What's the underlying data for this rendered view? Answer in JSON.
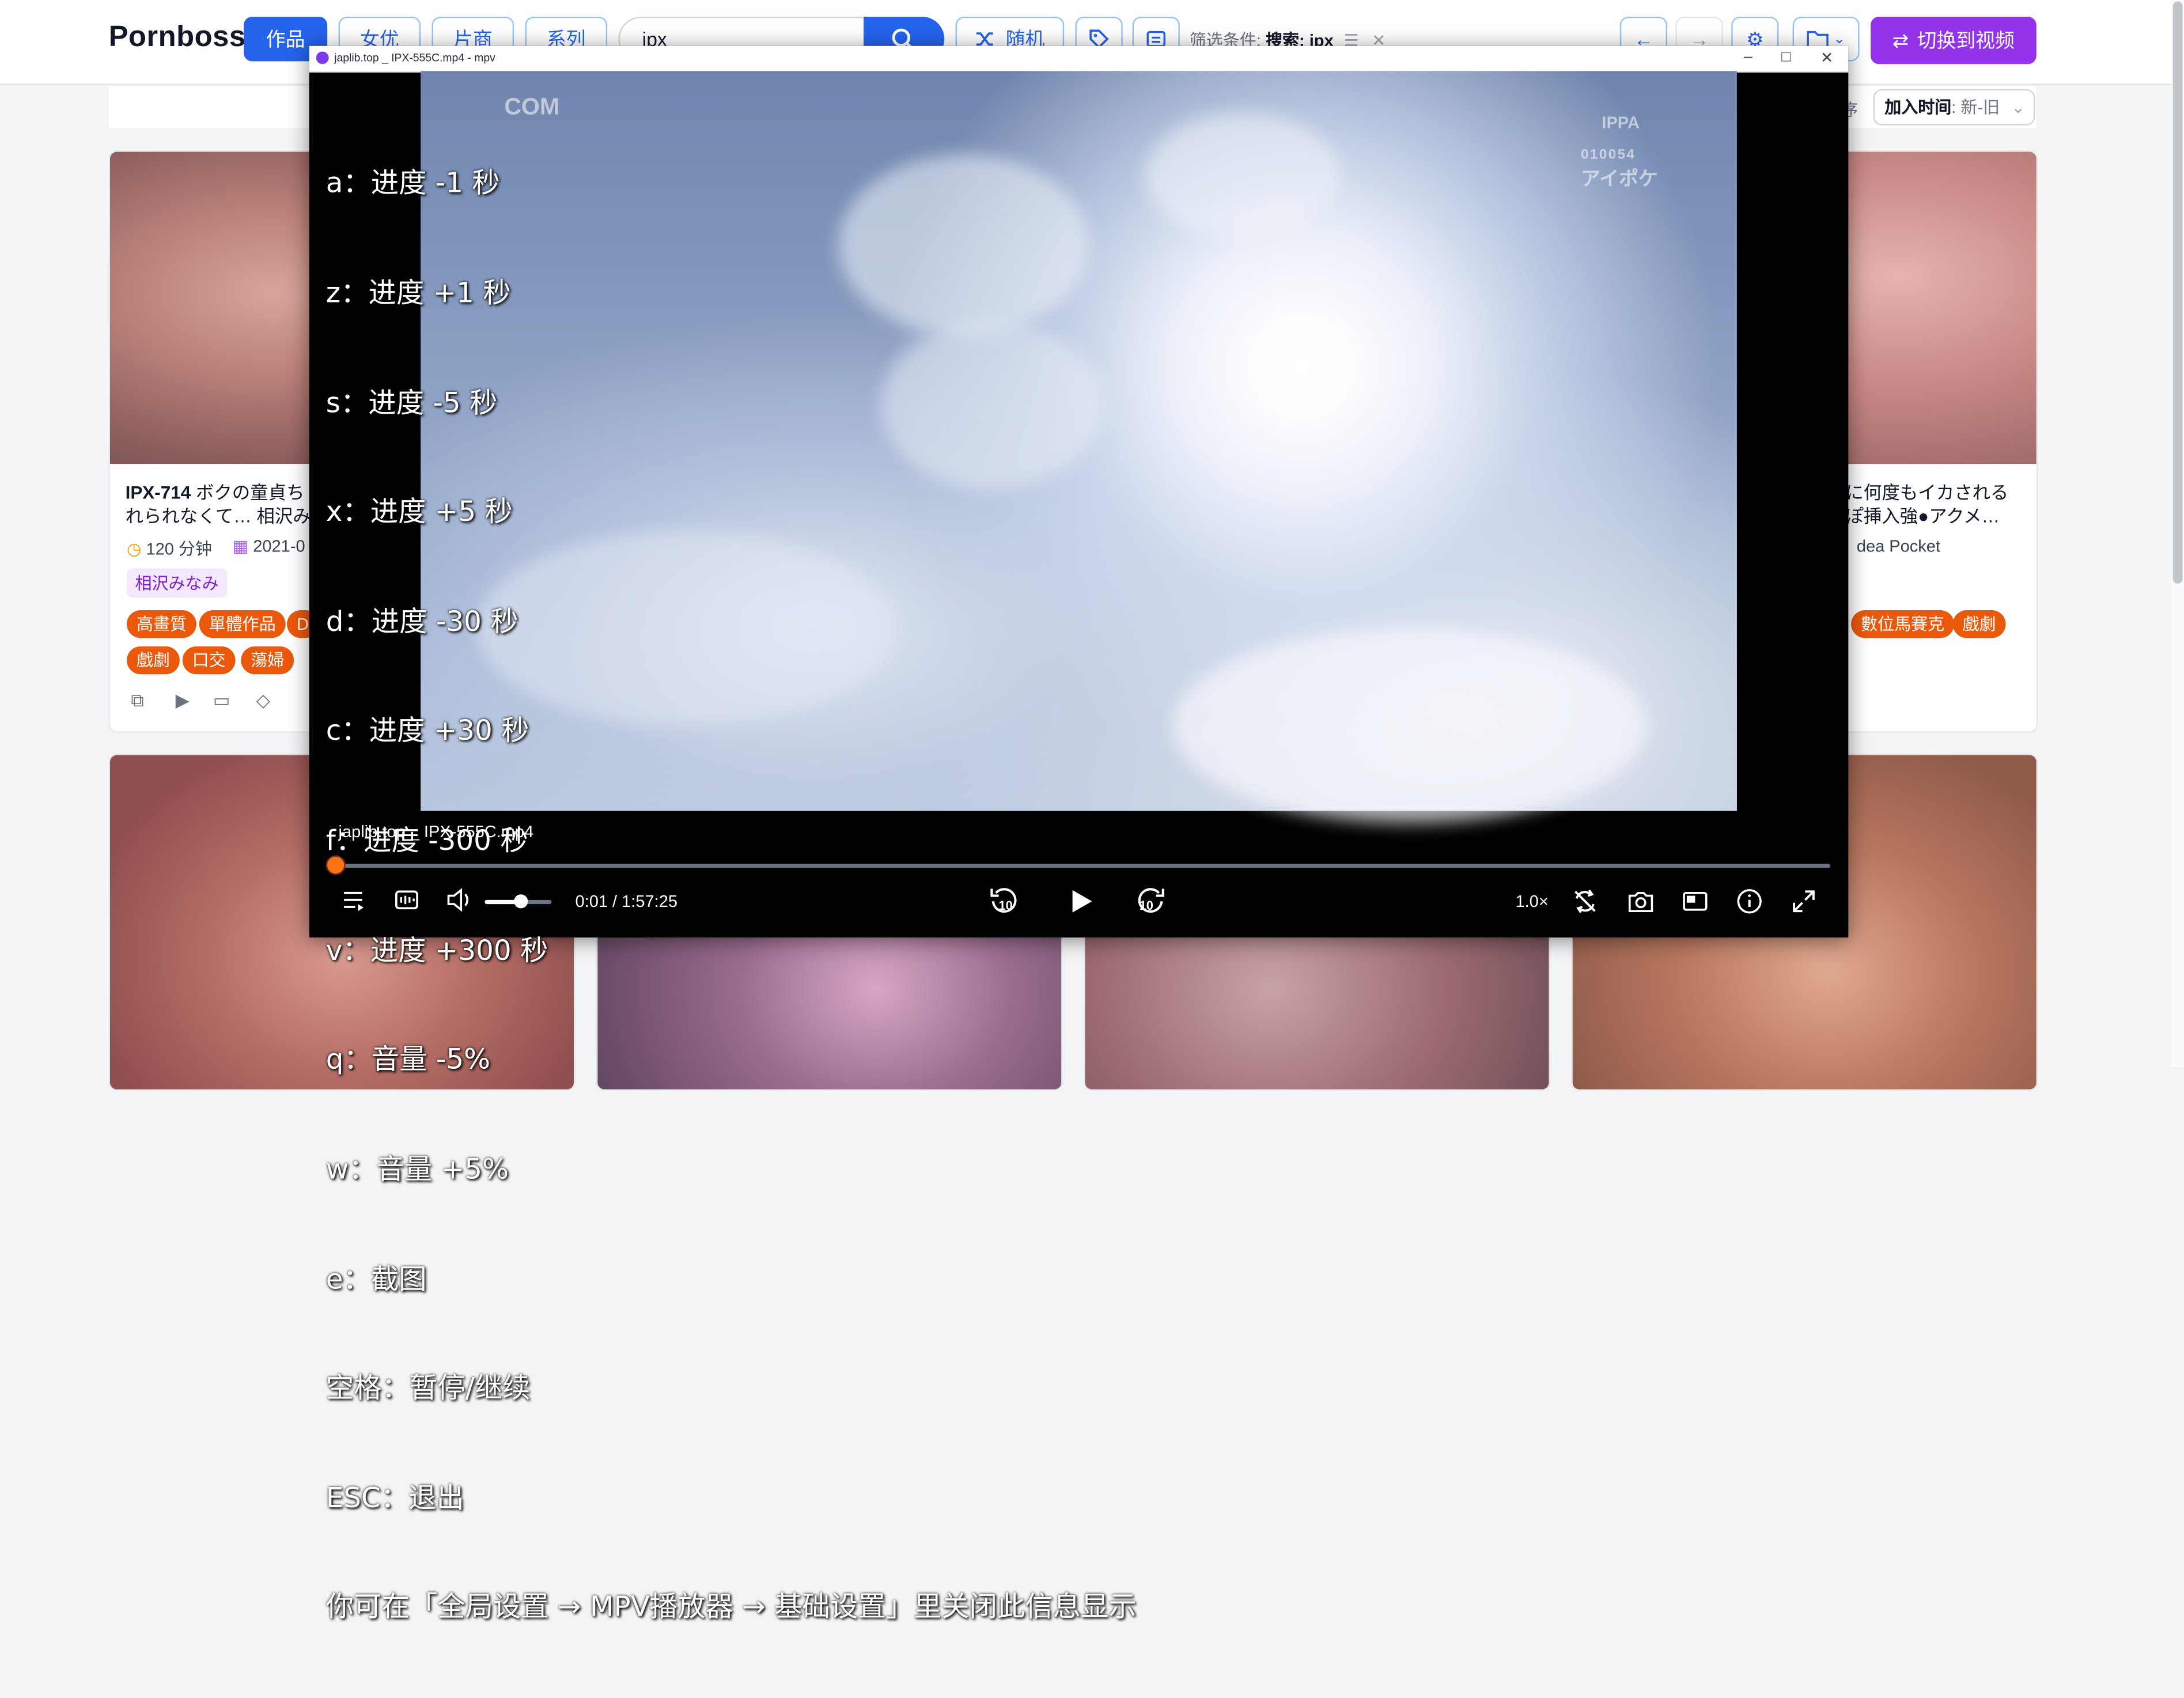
{
  "app": {
    "brand": "Pornboss",
    "nav": [
      "作品",
      "女优",
      "片商",
      "系列"
    ],
    "search_value": "ipx",
    "random_label": "随机",
    "filter_label": "筛选条件:",
    "filter_value": "搜索: ipx",
    "switch_label": "切换到视频",
    "sort_label": "序",
    "sort_field": "加入时间",
    "sort_order": ": 新-旧"
  },
  "cards": [
    {
      "code": "IPX-714",
      "title_rest": " ボクの童貞ち",
      "title_line2": "れられなくて… 相沢み",
      "duration": "120 分钟",
      "date": "2021-0",
      "actress": "相沢みなみ",
      "tags_row1": [
        "高畫質",
        "單體作品",
        "D"
      ],
      "tags_row2": [
        "戲劇",
        "口交",
        "蕩婦"
      ]
    },
    {
      "title_line1": "に何度もイカされる",
      "title_line2": "ぽ挿入強●アクメ…",
      "studio": "dea Pocket",
      "tags_row1": [
        "數位馬賽克",
        "戲劇"
      ]
    }
  ],
  "mpv": {
    "window_title": "japlib.top _ IPX-555C.mp4 - mpv",
    "osd_lines": [
      "a：进度 -1 秒",
      "z：进度 +1 秒",
      "s：进度 -5 秒",
      "x：进度 +5 秒",
      "d：进度 -30 秒",
      "c：进度 +30 秒",
      "f：进度 -300 秒",
      "v：进度 +300 秒",
      "q：音量 -5%",
      "w：音量 +5%",
      "e：截图",
      "空格：暂停/继续",
      "ESC：退出",
      "你可在「全局设置 → MPV播放器 → 基础设置」里关闭此信息显示"
    ],
    "watermark_left": "COM",
    "watermark_right_top": "IPPA",
    "watermark_right_code": "010054",
    "watermark_right_brand": "アイポケ",
    "filename": "japlib.top _ IPX-555C.mp4",
    "time": "0:01 / 1:57:25",
    "speed": "1.0×",
    "seek_progress": 0.0001,
    "volume_level": 0.55,
    "accent_color": "#f97316"
  }
}
